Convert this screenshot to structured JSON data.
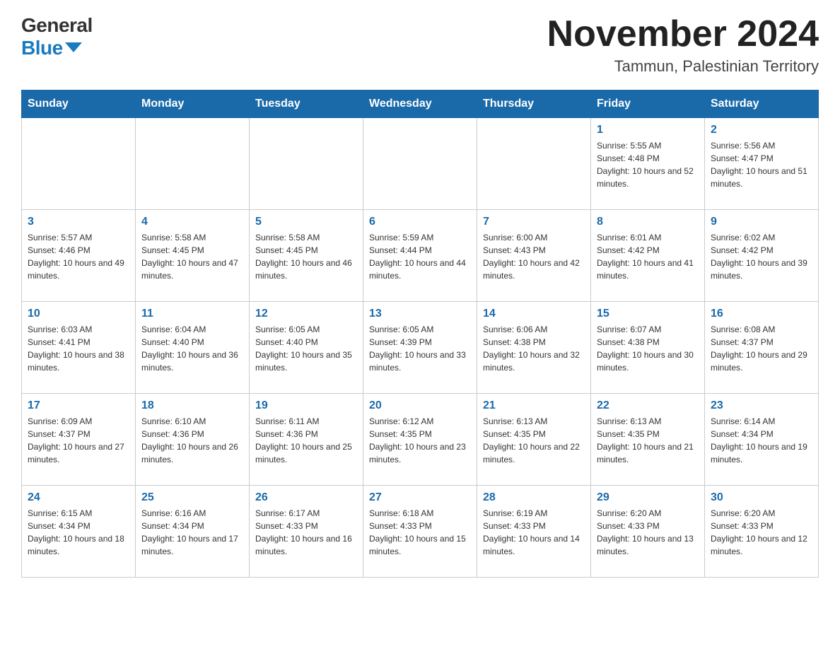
{
  "header": {
    "logo_line1": "General",
    "logo_line2": "Blue",
    "month_title": "November 2024",
    "location": "Tammun, Palestinian Territory"
  },
  "calendar": {
    "weekdays": [
      "Sunday",
      "Monday",
      "Tuesday",
      "Wednesday",
      "Thursday",
      "Friday",
      "Saturday"
    ],
    "rows": [
      [
        {
          "day": "",
          "info": ""
        },
        {
          "day": "",
          "info": ""
        },
        {
          "day": "",
          "info": ""
        },
        {
          "day": "",
          "info": ""
        },
        {
          "day": "",
          "info": ""
        },
        {
          "day": "1",
          "info": "Sunrise: 5:55 AM\nSunset: 4:48 PM\nDaylight: 10 hours and 52 minutes."
        },
        {
          "day": "2",
          "info": "Sunrise: 5:56 AM\nSunset: 4:47 PM\nDaylight: 10 hours and 51 minutes."
        }
      ],
      [
        {
          "day": "3",
          "info": "Sunrise: 5:57 AM\nSunset: 4:46 PM\nDaylight: 10 hours and 49 minutes."
        },
        {
          "day": "4",
          "info": "Sunrise: 5:58 AM\nSunset: 4:45 PM\nDaylight: 10 hours and 47 minutes."
        },
        {
          "day": "5",
          "info": "Sunrise: 5:58 AM\nSunset: 4:45 PM\nDaylight: 10 hours and 46 minutes."
        },
        {
          "day": "6",
          "info": "Sunrise: 5:59 AM\nSunset: 4:44 PM\nDaylight: 10 hours and 44 minutes."
        },
        {
          "day": "7",
          "info": "Sunrise: 6:00 AM\nSunset: 4:43 PM\nDaylight: 10 hours and 42 minutes."
        },
        {
          "day": "8",
          "info": "Sunrise: 6:01 AM\nSunset: 4:42 PM\nDaylight: 10 hours and 41 minutes."
        },
        {
          "day": "9",
          "info": "Sunrise: 6:02 AM\nSunset: 4:42 PM\nDaylight: 10 hours and 39 minutes."
        }
      ],
      [
        {
          "day": "10",
          "info": "Sunrise: 6:03 AM\nSunset: 4:41 PM\nDaylight: 10 hours and 38 minutes."
        },
        {
          "day": "11",
          "info": "Sunrise: 6:04 AM\nSunset: 4:40 PM\nDaylight: 10 hours and 36 minutes."
        },
        {
          "day": "12",
          "info": "Sunrise: 6:05 AM\nSunset: 4:40 PM\nDaylight: 10 hours and 35 minutes."
        },
        {
          "day": "13",
          "info": "Sunrise: 6:05 AM\nSunset: 4:39 PM\nDaylight: 10 hours and 33 minutes."
        },
        {
          "day": "14",
          "info": "Sunrise: 6:06 AM\nSunset: 4:38 PM\nDaylight: 10 hours and 32 minutes."
        },
        {
          "day": "15",
          "info": "Sunrise: 6:07 AM\nSunset: 4:38 PM\nDaylight: 10 hours and 30 minutes."
        },
        {
          "day": "16",
          "info": "Sunrise: 6:08 AM\nSunset: 4:37 PM\nDaylight: 10 hours and 29 minutes."
        }
      ],
      [
        {
          "day": "17",
          "info": "Sunrise: 6:09 AM\nSunset: 4:37 PM\nDaylight: 10 hours and 27 minutes."
        },
        {
          "day": "18",
          "info": "Sunrise: 6:10 AM\nSunset: 4:36 PM\nDaylight: 10 hours and 26 minutes."
        },
        {
          "day": "19",
          "info": "Sunrise: 6:11 AM\nSunset: 4:36 PM\nDaylight: 10 hours and 25 minutes."
        },
        {
          "day": "20",
          "info": "Sunrise: 6:12 AM\nSunset: 4:35 PM\nDaylight: 10 hours and 23 minutes."
        },
        {
          "day": "21",
          "info": "Sunrise: 6:13 AM\nSunset: 4:35 PM\nDaylight: 10 hours and 22 minutes."
        },
        {
          "day": "22",
          "info": "Sunrise: 6:13 AM\nSunset: 4:35 PM\nDaylight: 10 hours and 21 minutes."
        },
        {
          "day": "23",
          "info": "Sunrise: 6:14 AM\nSunset: 4:34 PM\nDaylight: 10 hours and 19 minutes."
        }
      ],
      [
        {
          "day": "24",
          "info": "Sunrise: 6:15 AM\nSunset: 4:34 PM\nDaylight: 10 hours and 18 minutes."
        },
        {
          "day": "25",
          "info": "Sunrise: 6:16 AM\nSunset: 4:34 PM\nDaylight: 10 hours and 17 minutes."
        },
        {
          "day": "26",
          "info": "Sunrise: 6:17 AM\nSunset: 4:33 PM\nDaylight: 10 hours and 16 minutes."
        },
        {
          "day": "27",
          "info": "Sunrise: 6:18 AM\nSunset: 4:33 PM\nDaylight: 10 hours and 15 minutes."
        },
        {
          "day": "28",
          "info": "Sunrise: 6:19 AM\nSunset: 4:33 PM\nDaylight: 10 hours and 14 minutes."
        },
        {
          "day": "29",
          "info": "Sunrise: 6:20 AM\nSunset: 4:33 PM\nDaylight: 10 hours and 13 minutes."
        },
        {
          "day": "30",
          "info": "Sunrise: 6:20 AM\nSunset: 4:33 PM\nDaylight: 10 hours and 12 minutes."
        }
      ]
    ]
  }
}
